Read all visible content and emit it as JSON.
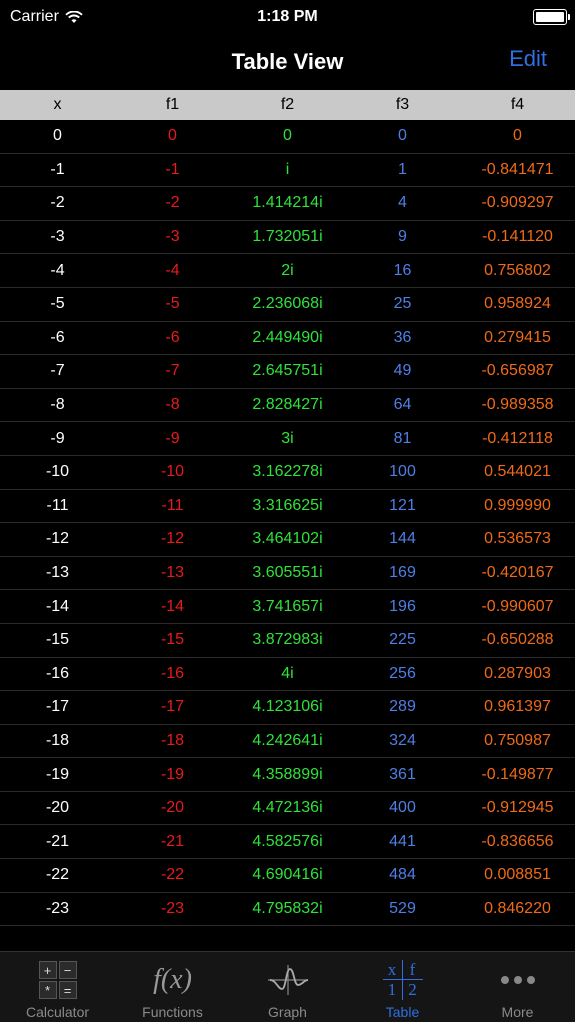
{
  "status": {
    "carrier": "Carrier",
    "time": "1:18 PM"
  },
  "nav": {
    "title": "Table View",
    "edit": "Edit"
  },
  "columns": [
    "x",
    "f1",
    "f2",
    "f3",
    "f4"
  ],
  "colors": {
    "f1": "#e81b1b",
    "f2": "#2ee23a",
    "f3": "#4f7fe6",
    "f4": "#ef6a17",
    "accent": "#2f6fe0"
  },
  "rows": [
    [
      "0",
      "0",
      "0",
      "0",
      "0"
    ],
    [
      "-1",
      "-1",
      "i",
      "1",
      "-0.841471"
    ],
    [
      "-2",
      "-2",
      "1.414214i",
      "4",
      "-0.909297"
    ],
    [
      "-3",
      "-3",
      "1.732051i",
      "9",
      "-0.141120"
    ],
    [
      "-4",
      "-4",
      "2i",
      "16",
      "0.756802"
    ],
    [
      "-5",
      "-5",
      "2.236068i",
      "25",
      "0.958924"
    ],
    [
      "-6",
      "-6",
      "2.449490i",
      "36",
      "0.279415"
    ],
    [
      "-7",
      "-7",
      "2.645751i",
      "49",
      "-0.656987"
    ],
    [
      "-8",
      "-8",
      "2.828427i",
      "64",
      "-0.989358"
    ],
    [
      "-9",
      "-9",
      "3i",
      "81",
      "-0.412118"
    ],
    [
      "-10",
      "-10",
      "3.162278i",
      "100",
      "0.544021"
    ],
    [
      "-11",
      "-11",
      "3.316625i",
      "121",
      "0.999990"
    ],
    [
      "-12",
      "-12",
      "3.464102i",
      "144",
      "0.536573"
    ],
    [
      "-13",
      "-13",
      "3.605551i",
      "169",
      "-0.420167"
    ],
    [
      "-14",
      "-14",
      "3.741657i",
      "196",
      "-0.990607"
    ],
    [
      "-15",
      "-15",
      "3.872983i",
      "225",
      "-0.650288"
    ],
    [
      "-16",
      "-16",
      "4i",
      "256",
      "0.287903"
    ],
    [
      "-17",
      "-17",
      "4.123106i",
      "289",
      "0.961397"
    ],
    [
      "-18",
      "-18",
      "4.242641i",
      "324",
      "0.750987"
    ],
    [
      "-19",
      "-19",
      "4.358899i",
      "361",
      "-0.149877"
    ],
    [
      "-20",
      "-20",
      "4.472136i",
      "400",
      "-0.912945"
    ],
    [
      "-21",
      "-21",
      "4.582576i",
      "441",
      "-0.836656"
    ],
    [
      "-22",
      "-22",
      "4.690416i",
      "484",
      "0.008851"
    ],
    [
      "-23",
      "-23",
      "4.795832i",
      "529",
      "0.846220"
    ]
  ],
  "tabs": [
    {
      "label": "Calculator",
      "icon": "calculator-icon",
      "active": false
    },
    {
      "label": "Functions",
      "icon": "function-icon",
      "active": false
    },
    {
      "label": "Graph",
      "icon": "graph-icon",
      "active": false
    },
    {
      "label": "Table",
      "icon": "table-icon",
      "active": true
    },
    {
      "label": "More",
      "icon": "more-icon",
      "active": false
    }
  ],
  "calc_icon_keys": [
    "+",
    "−",
    "*",
    "="
  ],
  "fx_icon_text": "f(x)",
  "table_icon_text": [
    "x",
    "f",
    "1",
    "2"
  ]
}
